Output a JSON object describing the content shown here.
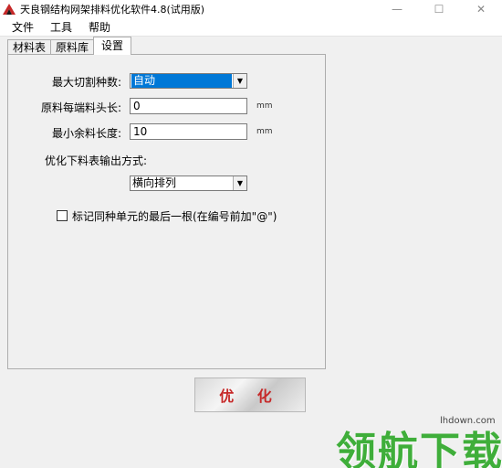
{
  "window": {
    "title": "天良钢结构网架排料优化软件4.8(试用版)",
    "controls": {
      "minimize": "—",
      "maximize": "☐",
      "close": "✕"
    }
  },
  "menu": [
    "文件",
    "工具",
    "帮助"
  ],
  "tabs": [
    {
      "label": "材料表",
      "active": false
    },
    {
      "label": "原料库",
      "active": false
    },
    {
      "label": "设置",
      "active": true
    }
  ],
  "settings": {
    "max_cut_types_label": "最大切割种数:",
    "max_cut_types_value": "自动",
    "head_length_label": "原料每端料头长:",
    "head_length_value": "0",
    "head_length_unit": "mm",
    "min_remain_label": "最小余料长度:",
    "min_remain_value": "10",
    "min_remain_unit": "mm",
    "output_mode_label": "优化下料表输出方式:",
    "output_mode_value": "横向排列",
    "mark_last_label": "标记同种单元的最后一根(在编号前加\"@\")",
    "mark_last_checked": false
  },
  "optimize_button": "优 化",
  "watermark": {
    "text": "领航下载",
    "domain": "lhdown.com"
  }
}
